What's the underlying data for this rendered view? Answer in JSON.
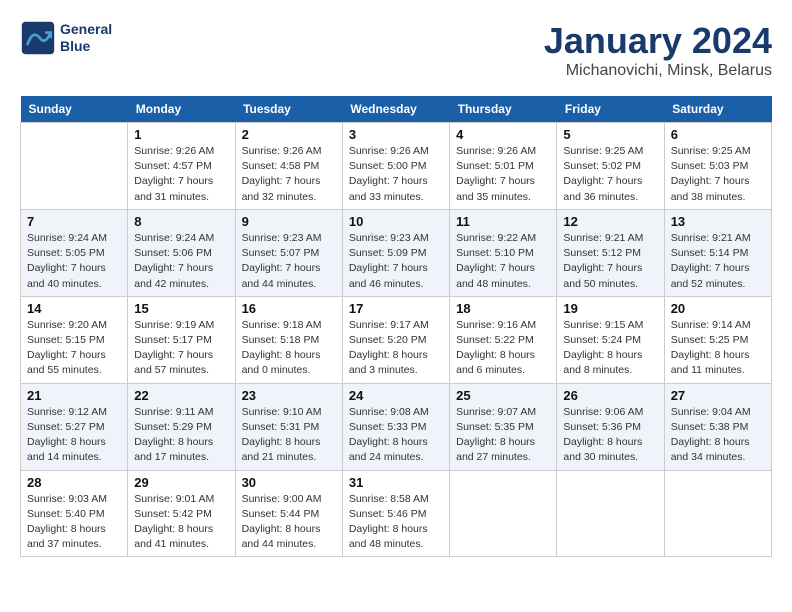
{
  "header": {
    "logo_line1": "General",
    "logo_line2": "Blue",
    "title": "January 2024",
    "subtitle": "Michanovichi, Minsk, Belarus"
  },
  "weekdays": [
    "Sunday",
    "Monday",
    "Tuesday",
    "Wednesday",
    "Thursday",
    "Friday",
    "Saturday"
  ],
  "weeks": [
    [
      {
        "day": "",
        "sunrise": "",
        "sunset": "",
        "daylight": ""
      },
      {
        "day": "1",
        "sunrise": "Sunrise: 9:26 AM",
        "sunset": "Sunset: 4:57 PM",
        "daylight": "Daylight: 7 hours and 31 minutes."
      },
      {
        "day": "2",
        "sunrise": "Sunrise: 9:26 AM",
        "sunset": "Sunset: 4:58 PM",
        "daylight": "Daylight: 7 hours and 32 minutes."
      },
      {
        "day": "3",
        "sunrise": "Sunrise: 9:26 AM",
        "sunset": "Sunset: 5:00 PM",
        "daylight": "Daylight: 7 hours and 33 minutes."
      },
      {
        "day": "4",
        "sunrise": "Sunrise: 9:26 AM",
        "sunset": "Sunset: 5:01 PM",
        "daylight": "Daylight: 7 hours and 35 minutes."
      },
      {
        "day": "5",
        "sunrise": "Sunrise: 9:25 AM",
        "sunset": "Sunset: 5:02 PM",
        "daylight": "Daylight: 7 hours and 36 minutes."
      },
      {
        "day": "6",
        "sunrise": "Sunrise: 9:25 AM",
        "sunset": "Sunset: 5:03 PM",
        "daylight": "Daylight: 7 hours and 38 minutes."
      }
    ],
    [
      {
        "day": "7",
        "sunrise": "Sunrise: 9:24 AM",
        "sunset": "Sunset: 5:05 PM",
        "daylight": "Daylight: 7 hours and 40 minutes."
      },
      {
        "day": "8",
        "sunrise": "Sunrise: 9:24 AM",
        "sunset": "Sunset: 5:06 PM",
        "daylight": "Daylight: 7 hours and 42 minutes."
      },
      {
        "day": "9",
        "sunrise": "Sunrise: 9:23 AM",
        "sunset": "Sunset: 5:07 PM",
        "daylight": "Daylight: 7 hours and 44 minutes."
      },
      {
        "day": "10",
        "sunrise": "Sunrise: 9:23 AM",
        "sunset": "Sunset: 5:09 PM",
        "daylight": "Daylight: 7 hours and 46 minutes."
      },
      {
        "day": "11",
        "sunrise": "Sunrise: 9:22 AM",
        "sunset": "Sunset: 5:10 PM",
        "daylight": "Daylight: 7 hours and 48 minutes."
      },
      {
        "day": "12",
        "sunrise": "Sunrise: 9:21 AM",
        "sunset": "Sunset: 5:12 PM",
        "daylight": "Daylight: 7 hours and 50 minutes."
      },
      {
        "day": "13",
        "sunrise": "Sunrise: 9:21 AM",
        "sunset": "Sunset: 5:14 PM",
        "daylight": "Daylight: 7 hours and 52 minutes."
      }
    ],
    [
      {
        "day": "14",
        "sunrise": "Sunrise: 9:20 AM",
        "sunset": "Sunset: 5:15 PM",
        "daylight": "Daylight: 7 hours and 55 minutes."
      },
      {
        "day": "15",
        "sunrise": "Sunrise: 9:19 AM",
        "sunset": "Sunset: 5:17 PM",
        "daylight": "Daylight: 7 hours and 57 minutes."
      },
      {
        "day": "16",
        "sunrise": "Sunrise: 9:18 AM",
        "sunset": "Sunset: 5:18 PM",
        "daylight": "Daylight: 8 hours and 0 minutes."
      },
      {
        "day": "17",
        "sunrise": "Sunrise: 9:17 AM",
        "sunset": "Sunset: 5:20 PM",
        "daylight": "Daylight: 8 hours and 3 minutes."
      },
      {
        "day": "18",
        "sunrise": "Sunrise: 9:16 AM",
        "sunset": "Sunset: 5:22 PM",
        "daylight": "Daylight: 8 hours and 6 minutes."
      },
      {
        "day": "19",
        "sunrise": "Sunrise: 9:15 AM",
        "sunset": "Sunset: 5:24 PM",
        "daylight": "Daylight: 8 hours and 8 minutes."
      },
      {
        "day": "20",
        "sunrise": "Sunrise: 9:14 AM",
        "sunset": "Sunset: 5:25 PM",
        "daylight": "Daylight: 8 hours and 11 minutes."
      }
    ],
    [
      {
        "day": "21",
        "sunrise": "Sunrise: 9:12 AM",
        "sunset": "Sunset: 5:27 PM",
        "daylight": "Daylight: 8 hours and 14 minutes."
      },
      {
        "day": "22",
        "sunrise": "Sunrise: 9:11 AM",
        "sunset": "Sunset: 5:29 PM",
        "daylight": "Daylight: 8 hours and 17 minutes."
      },
      {
        "day": "23",
        "sunrise": "Sunrise: 9:10 AM",
        "sunset": "Sunset: 5:31 PM",
        "daylight": "Daylight: 8 hours and 21 minutes."
      },
      {
        "day": "24",
        "sunrise": "Sunrise: 9:08 AM",
        "sunset": "Sunset: 5:33 PM",
        "daylight": "Daylight: 8 hours and 24 minutes."
      },
      {
        "day": "25",
        "sunrise": "Sunrise: 9:07 AM",
        "sunset": "Sunset: 5:35 PM",
        "daylight": "Daylight: 8 hours and 27 minutes."
      },
      {
        "day": "26",
        "sunrise": "Sunrise: 9:06 AM",
        "sunset": "Sunset: 5:36 PM",
        "daylight": "Daylight: 8 hours and 30 minutes."
      },
      {
        "day": "27",
        "sunrise": "Sunrise: 9:04 AM",
        "sunset": "Sunset: 5:38 PM",
        "daylight": "Daylight: 8 hours and 34 minutes."
      }
    ],
    [
      {
        "day": "28",
        "sunrise": "Sunrise: 9:03 AM",
        "sunset": "Sunset: 5:40 PM",
        "daylight": "Daylight: 8 hours and 37 minutes."
      },
      {
        "day": "29",
        "sunrise": "Sunrise: 9:01 AM",
        "sunset": "Sunset: 5:42 PM",
        "daylight": "Daylight: 8 hours and 41 minutes."
      },
      {
        "day": "30",
        "sunrise": "Sunrise: 9:00 AM",
        "sunset": "Sunset: 5:44 PM",
        "daylight": "Daylight: 8 hours and 44 minutes."
      },
      {
        "day": "31",
        "sunrise": "Sunrise: 8:58 AM",
        "sunset": "Sunset: 5:46 PM",
        "daylight": "Daylight: 8 hours and 48 minutes."
      },
      {
        "day": "",
        "sunrise": "",
        "sunset": "",
        "daylight": ""
      },
      {
        "day": "",
        "sunrise": "",
        "sunset": "",
        "daylight": ""
      },
      {
        "day": "",
        "sunrise": "",
        "sunset": "",
        "daylight": ""
      }
    ]
  ]
}
